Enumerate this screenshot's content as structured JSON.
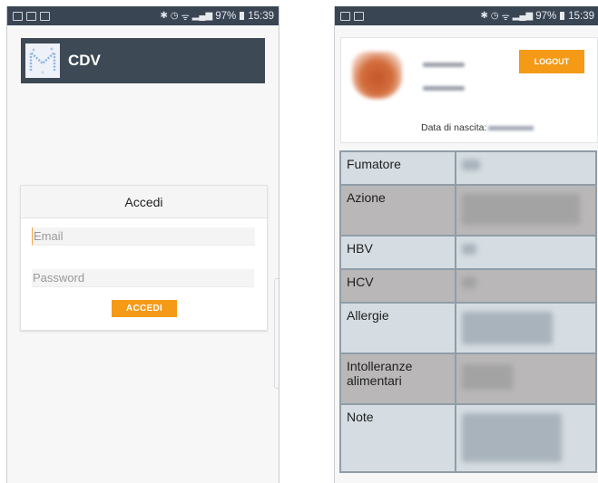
{
  "status_bar": {
    "battery": "97%",
    "time": "15:39"
  },
  "login_screen": {
    "app_title": "CDV",
    "card_title": "Accedi",
    "email_placeholder": "Email",
    "password_placeholder": "Password",
    "submit_label": "ACCEDI"
  },
  "profile_screen": {
    "logout_label": "LOGOUT",
    "dob_label": "Data di nascita:",
    "rows": [
      {
        "label": "Fumatore",
        "shade": "light"
      },
      {
        "label": "Azione",
        "shade": "dark"
      },
      {
        "label": "HBV",
        "shade": "light"
      },
      {
        "label": "HCV",
        "shade": "dark"
      },
      {
        "label": "Allergie",
        "shade": "light"
      },
      {
        "label": "Intolleranze alimentari",
        "shade": "dark"
      },
      {
        "label": "Note",
        "shade": "light"
      }
    ]
  },
  "colors": {
    "accent": "#f59a17",
    "appbar": "#3d4954",
    "status_bar": "#3a4553",
    "row_light": "#d5dde2",
    "row_dark": "#b9b7b7"
  }
}
